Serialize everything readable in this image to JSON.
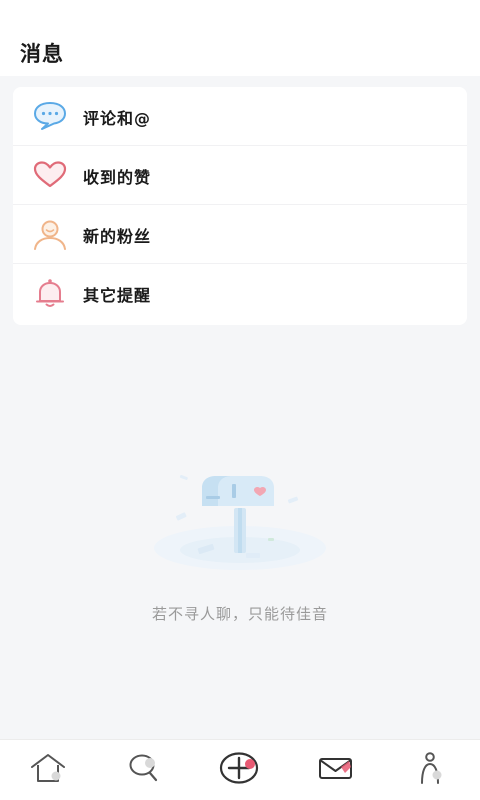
{
  "header": {
    "title": "消息"
  },
  "menu": {
    "items": [
      {
        "label": "评论和@",
        "icon": "comment-bubble-icon"
      },
      {
        "label": "收到的赞",
        "icon": "heart-icon"
      },
      {
        "label": "新的粉丝",
        "icon": "user-follower-icon"
      },
      {
        "label": "其它提醒",
        "icon": "bell-icon"
      }
    ]
  },
  "empty_state": {
    "text": "若不寻人聊，只能待佳音",
    "icon": "mailbox-illustration"
  },
  "bottom_nav": {
    "items": [
      {
        "icon": "home-icon"
      },
      {
        "icon": "search-icon"
      },
      {
        "icon": "add-icon"
      },
      {
        "icon": "mail-icon"
      },
      {
        "icon": "profile-icon"
      }
    ]
  },
  "colors": {
    "comment": "#5aa9e6",
    "heart": "#e06b78",
    "follower": "#f0b58a",
    "bell": "#e57d8e",
    "badge": "#e85a73"
  }
}
